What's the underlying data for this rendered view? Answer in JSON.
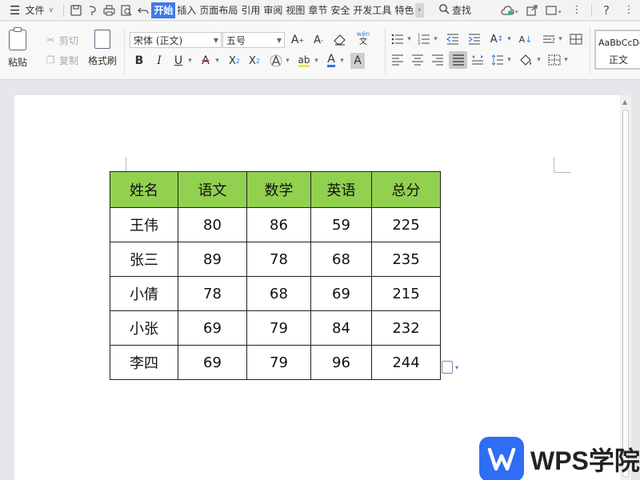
{
  "menubar": {
    "file_label": "文件",
    "tabs": [
      "开始",
      "插入",
      "页面布局",
      "引用",
      "审阅",
      "视图",
      "章节",
      "安全",
      "开发工具",
      "特色"
    ],
    "active_tab": "开始",
    "search_label": "查找"
  },
  "ribbon": {
    "paste_label": "粘贴",
    "cut_label": "剪切",
    "copy_label": "复制",
    "format_painter_label": "格式刷",
    "font_name": "宋体 (正文)",
    "font_size": "五号",
    "style_preview": "AaBbCcDd",
    "style_name": "正文"
  },
  "table": {
    "headers": [
      "姓名",
      "语文",
      "数学",
      "英语",
      "总分"
    ],
    "rows": [
      [
        "王伟",
        "80",
        "86",
        "59",
        "225"
      ],
      [
        "张三",
        "89",
        "78",
        "68",
        "235"
      ],
      [
        "小倩",
        "78",
        "68",
        "69",
        "215"
      ],
      [
        "小张",
        "69",
        "79",
        "84",
        "232"
      ],
      [
        "李四",
        "69",
        "79",
        "96",
        "244"
      ]
    ],
    "header_color": "#92d050"
  },
  "watermark": {
    "text": "WPS学院",
    "logo_color": "#2f6df5"
  },
  "colors": {
    "accent": "#3f7be8"
  }
}
